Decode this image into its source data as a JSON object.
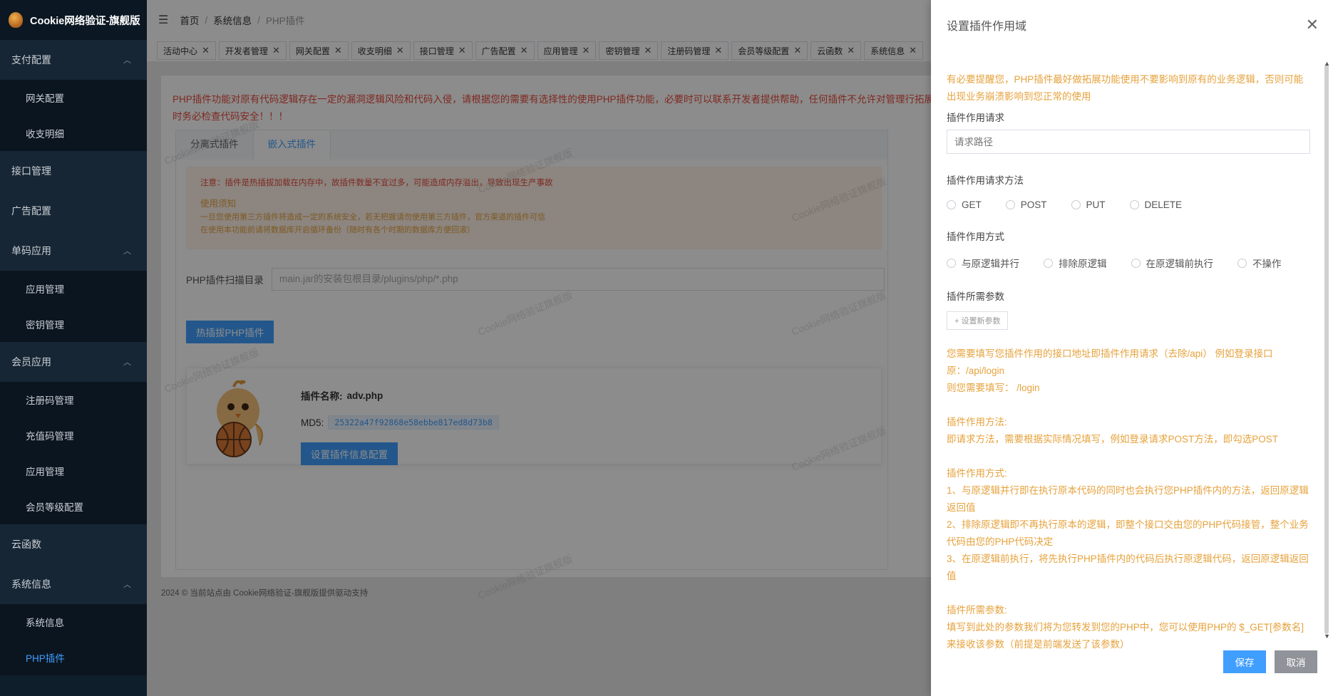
{
  "app": {
    "title": "Cookie网络验证-旗舰版"
  },
  "sidebar": {
    "items": [
      {
        "label": "支付配置",
        "type": "group"
      },
      {
        "label": "网关配置",
        "type": "sub"
      },
      {
        "label": "收支明细",
        "type": "sub"
      },
      {
        "label": "接口管理",
        "type": "item"
      },
      {
        "label": "广告配置",
        "type": "item"
      },
      {
        "label": "单码应用",
        "type": "group"
      },
      {
        "label": "应用管理",
        "type": "sub"
      },
      {
        "label": "密钥管理",
        "type": "sub"
      },
      {
        "label": "会员应用",
        "type": "group"
      },
      {
        "label": "注册码管理",
        "type": "sub"
      },
      {
        "label": "充值码管理",
        "type": "sub"
      },
      {
        "label": "应用管理",
        "type": "sub"
      },
      {
        "label": "会员等级配置",
        "type": "sub"
      },
      {
        "label": "云函数",
        "type": "item"
      },
      {
        "label": "系统信息",
        "type": "group"
      },
      {
        "label": "系统信息",
        "type": "sub"
      },
      {
        "label": "PHP插件",
        "type": "sub",
        "active": true
      }
    ]
  },
  "breadcrumb": {
    "home": "首页",
    "section": "系统信息",
    "current": "PHP插件"
  },
  "tabs": [
    "活动中心",
    "开发者管理",
    "网关配置",
    "收支明细",
    "接口管理",
    "广告配置",
    "应用管理",
    "密钥管理",
    "注册码管理",
    "会员等级配置",
    "云函数",
    "系统信息"
  ],
  "main": {
    "warning": "PHP插件功能对原有代码逻辑存在一定的漏洞逻辑风险和代码入侵，请根据您的需要有选择性的使用PHP插件功能，必要时可以联系开发者提供帮助，任何插件不允许对管理行拓展时务必检查代码安全！！！",
    "subtabs": [
      "分离式插件",
      "嵌入式插件"
    ],
    "notice": {
      "line1": "注意：插件是热插拔加载在内存中，故插件数量不宜过多，可能造成内存溢出，导致出现生产事故",
      "head": "使用须知",
      "line2": "一旦您使用第三方插件将造成一定的系统安全，若无把握请勿使用第三方插件，官方渠道的插件可信",
      "line3": "在使用本功能前请将数据库开启循环备份（随时有各个时期的数据库方便回滚）"
    },
    "scan_label": "PHP插件扫描目录",
    "scan_value": "main.jar的安装包根目录/plugins/php/*.php",
    "hot_button": "热插拔PHP插件",
    "plugin": {
      "name_label": "插件名称:",
      "name": "adv.php",
      "md5_label": "MD5:",
      "md5": "25322a47f92868e58ebbe817ed8d73b8",
      "config_button": "设置插件信息配置"
    },
    "footer": "2024 © 当前站点由 Cookie网络验证-旗舰版提供驱动支持",
    "watermark": "Cookie网络验证旗舰版"
  },
  "drawer": {
    "title": "设置插件作用域",
    "tip": "有必要提醒您，PHP插件最好做拓展功能使用不要影响到原有的业务逻辑，否则可能出现业务崩溃影响到您正常的使用",
    "request_label": "插件作用请求",
    "request_placeholder": "请求路径",
    "method_label": "插件作用请求方法",
    "methods": [
      "GET",
      "POST",
      "PUT",
      "DELETE"
    ],
    "mode_label": "插件作用方式",
    "modes": [
      "与原逻辑并行",
      "排除原逻辑",
      "在原逻辑前执行",
      "不操作"
    ],
    "params_label": "插件所需参数",
    "add_param": "+ 设置新参数",
    "help": [
      "您需要填写您插件作用的接口地址即插件作用请求（去除/api） 例如登录接口原：/api/login",
      "则您需要填写： /login",
      "",
      "插件作用方法:",
      "即请求方法，需要根据实际情况填写，例如登录请求POST方法，即勾选POST",
      "",
      "插件作用方式:",
      "1、与原逻辑并行即在执行原本代码的同时也会执行您PHP插件内的方法，返回原逻辑返回值",
      "2、排除原逻辑即不再执行原本的逻辑，即整个接口交由您的PHP代码接管，整个业务代码由您的PHP代码决定",
      "3、在原逻辑前执行，将先执行PHP插件内的代码后执行原逻辑代码，返回原逻辑返回值",
      "",
      "插件所需参数:",
      "填写到此处的参数我们将为您转发到您的PHP中，您可以使用PHP的 $_GET[参数名] 来接收该参数（前提是前端发送了该参数）"
    ],
    "save": "保存",
    "cancel": "取消"
  }
}
